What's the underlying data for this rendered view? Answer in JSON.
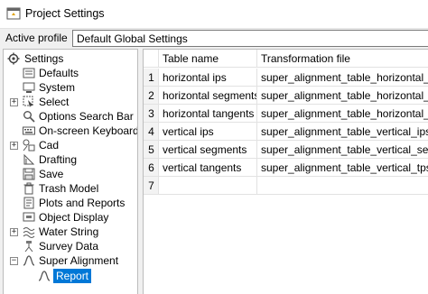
{
  "window": {
    "title": "Project Settings",
    "icon": "project-settings-icon"
  },
  "profile": {
    "label": "Active profile",
    "value": "Default Global Settings"
  },
  "tree": {
    "root": "Settings",
    "items": [
      {
        "label": "Defaults",
        "icon": "defaults-icon",
        "expandable": false
      },
      {
        "label": "System",
        "icon": "system-icon",
        "expandable": false
      },
      {
        "label": "Select",
        "icon": "select-icon",
        "expandable": true
      },
      {
        "label": "Options Search Bar",
        "icon": "search-bar-icon",
        "expandable": false
      },
      {
        "label": "On-screen Keyboard",
        "icon": "keyboard-icon",
        "expandable": false
      },
      {
        "label": "Cad",
        "icon": "cad-icon",
        "expandable": true
      },
      {
        "label": "Drafting",
        "icon": "drafting-icon",
        "expandable": false
      },
      {
        "label": "Save",
        "icon": "save-icon",
        "expandable": false
      },
      {
        "label": "Trash Model",
        "icon": "trash-icon",
        "expandable": false
      },
      {
        "label": "Plots and Reports",
        "icon": "plots-icon",
        "expandable": false
      },
      {
        "label": "Object Display",
        "icon": "object-display-icon",
        "expandable": false
      },
      {
        "label": "Water String",
        "icon": "water-string-icon",
        "expandable": true
      },
      {
        "label": "Survey Data",
        "icon": "survey-data-icon",
        "expandable": false
      },
      {
        "label": "Super Alignment",
        "icon": "super-alignment-icon",
        "expandable": true,
        "expanded": true
      }
    ],
    "child": {
      "label": "Report",
      "icon": "report-icon",
      "selected": true
    }
  },
  "table": {
    "headers": [
      "Table name",
      "Transformation file"
    ],
    "rows": [
      {
        "num": "1",
        "name": "horizontal ips",
        "file": "super_alignment_table_horizontal_ips.xslt"
      },
      {
        "num": "2",
        "name": "horizontal segments",
        "file": "super_alignment_table_horizontal_segments.xslt"
      },
      {
        "num": "3",
        "name": "horizontal tangents",
        "file": "super_alignment_table_horizontal_tps.xslt"
      },
      {
        "num": "4",
        "name": "vertical ips",
        "file": "super_alignment_table_vertical_ips.xslt"
      },
      {
        "num": "5",
        "name": "vertical segments",
        "file": "super_alignment_table_vertical_segments.xslt"
      },
      {
        "num": "6",
        "name": "vertical tangents",
        "file": "super_alignment_table_vertical_tps.xslt"
      },
      {
        "num": "7",
        "name": "",
        "file": ""
      }
    ]
  },
  "colors": {
    "selection": "#0078d7",
    "border": "#bcbcbc"
  }
}
